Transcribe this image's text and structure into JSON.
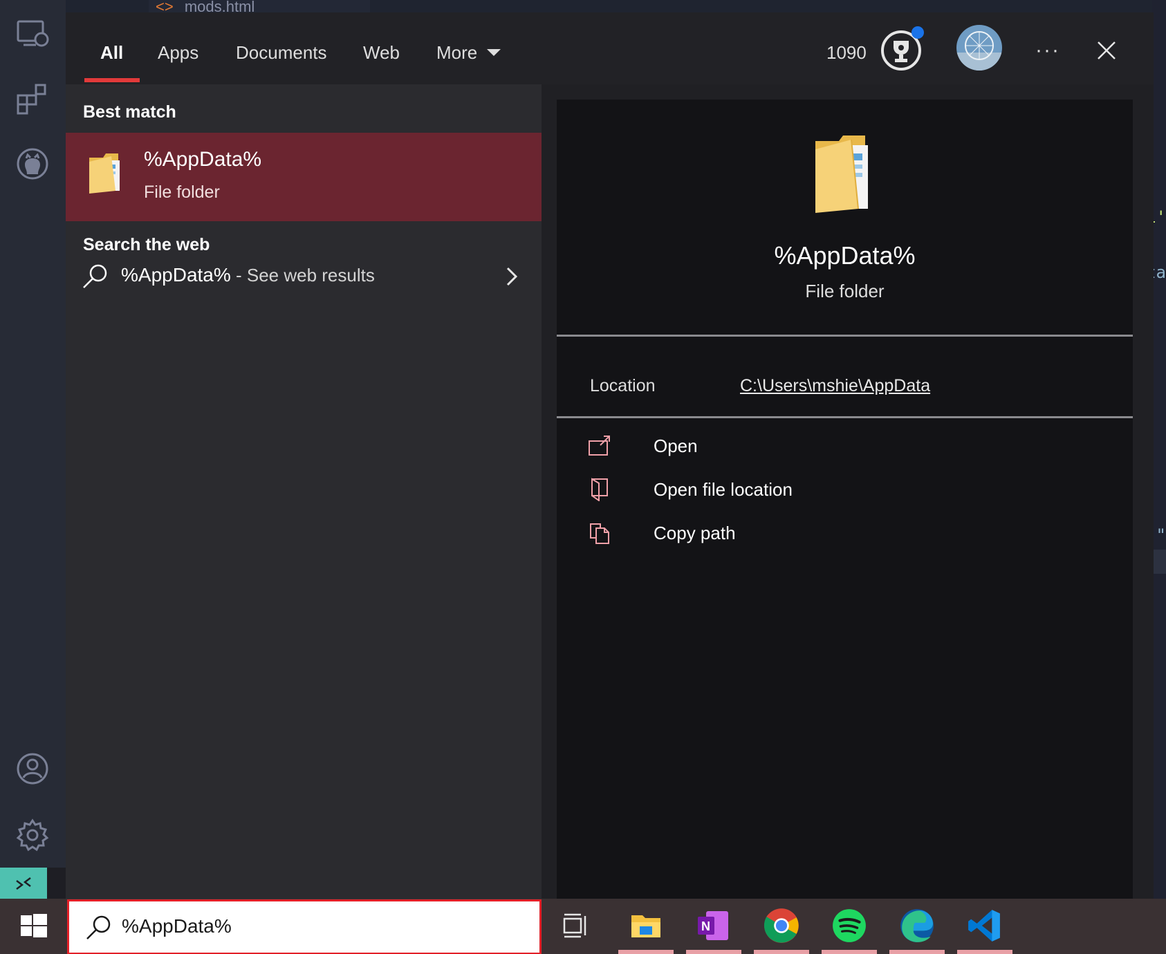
{
  "background": {
    "editor_tab_label": "mods.html",
    "editor_tab_line": "8",
    "edge_snippets": [
      "1'",
      "ta",
      "\""
    ]
  },
  "nav": {
    "tabs": [
      {
        "label": "All",
        "active": true
      },
      {
        "label": "Apps"
      },
      {
        "label": "Documents"
      },
      {
        "label": "Web"
      },
      {
        "label": "More"
      }
    ],
    "points": "1090",
    "more_options_glyph": "···"
  },
  "results": {
    "best_match_header": "Best match",
    "best_match": {
      "title": "%AppData%",
      "subtitle": "File folder"
    },
    "web_header": "Search the web",
    "web_item": {
      "query": "%AppData%",
      "suffix": " - See web results"
    }
  },
  "preview": {
    "title": "%AppData%",
    "subtitle": "File folder",
    "location_label": "Location",
    "location_value": "C:\\Users\\mshie\\AppData",
    "actions": [
      {
        "label": "Open",
        "icon": "open-icon"
      },
      {
        "label": "Open file location",
        "icon": "folder-location-icon"
      },
      {
        "label": "Copy path",
        "icon": "copy-icon"
      }
    ]
  },
  "taskbar": {
    "search_value": "%AppData%",
    "apps": [
      "task-view-icon",
      "file-explorer-icon",
      "onenote-icon",
      "chrome-icon",
      "spotify-icon",
      "edge-icon",
      "vscode-icon"
    ]
  },
  "colors": {
    "accent": "#e23a3a",
    "selection": "#6b2530",
    "taskbar": "#3a3133"
  }
}
